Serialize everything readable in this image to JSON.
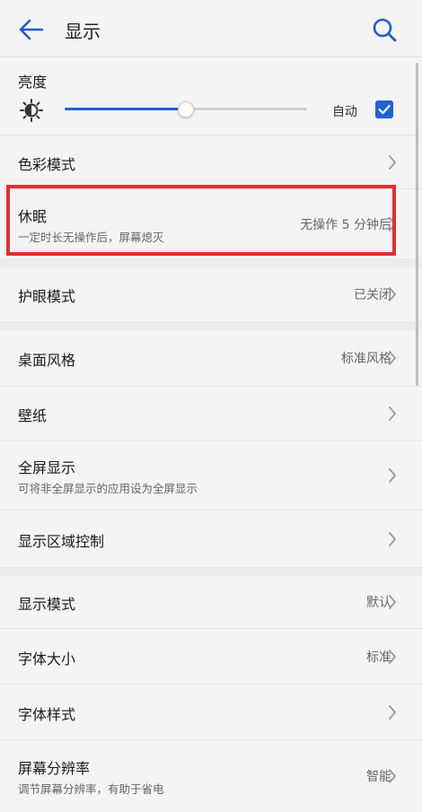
{
  "header": {
    "title": "显示"
  },
  "brightness": {
    "label": "亮度",
    "level": 0.5,
    "auto_label": "自动",
    "auto_checked": true
  },
  "colors": {
    "accent": "#1e63d6",
    "highlight": "#e52f2f"
  },
  "items": [
    {
      "title": "色彩模式",
      "subtitle": "",
      "value": ""
    },
    {
      "title": "休眠",
      "subtitle": "一定时长无操作后，屏幕熄灭",
      "value": "无操作 5 分钟后"
    },
    {
      "title": "护眼模式",
      "subtitle": "",
      "value": "已关闭"
    },
    {
      "title": "桌面风格",
      "subtitle": "",
      "value": "标准风格"
    },
    {
      "title": "壁纸",
      "subtitle": "",
      "value": ""
    },
    {
      "title": "全屏显示",
      "subtitle": "可将非全屏显示的应用设为全屏显示",
      "value": ""
    },
    {
      "title": "显示区域控制",
      "subtitle": "",
      "value": ""
    },
    {
      "title": "显示模式",
      "subtitle": "",
      "value": "默认"
    },
    {
      "title": "字体大小",
      "subtitle": "",
      "value": "标准"
    },
    {
      "title": "字体样式",
      "subtitle": "",
      "value": ""
    },
    {
      "title": "屏幕分辨率",
      "subtitle": "调节屏幕分辨率，有助于省电",
      "value": "智能"
    }
  ],
  "icons": [
    "back-arrow-icon",
    "search-icon",
    "sun-icon",
    "check-icon",
    "chevron-right-icon"
  ]
}
